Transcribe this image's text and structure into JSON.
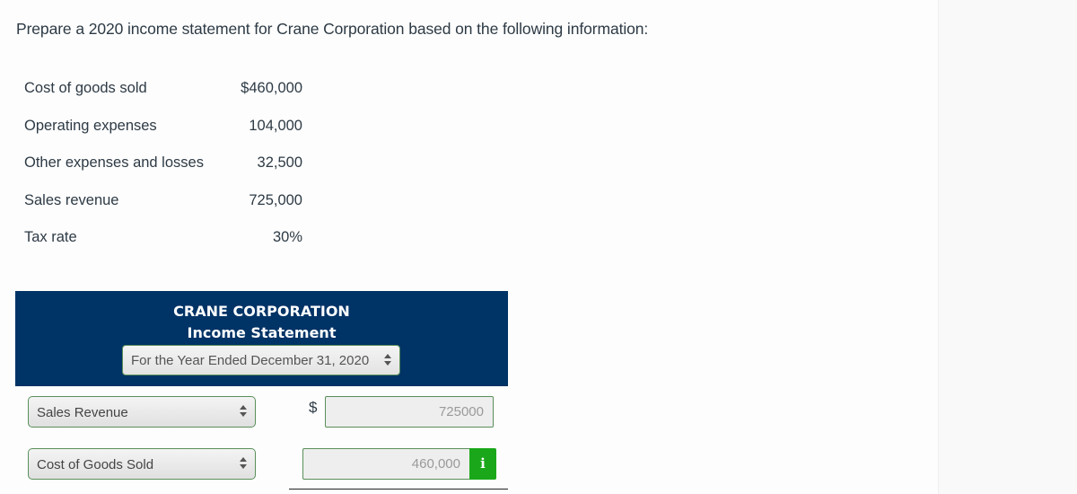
{
  "prompt": "Prepare a 2020 income statement for Crane Corporation based on the following information:",
  "given": [
    {
      "label": "Cost of goods sold",
      "value": "$460,000"
    },
    {
      "label": "Operating expenses",
      "value": "104,000"
    },
    {
      "label": "Other expenses and losses",
      "value": "32,500"
    },
    {
      "label": "Sales revenue",
      "value": "725,000"
    },
    {
      "label": "Tax rate",
      "value": "30%"
    }
  ],
  "statement": {
    "company": "CRANE CORPORATION",
    "title": "Income Statement",
    "period": "For the Year Ended December 31, 2020",
    "rows": [
      {
        "account": "Sales Revenue",
        "currency": "$",
        "amount": "725000"
      },
      {
        "account": "Cost of Goods Sold",
        "amount": "460,000",
        "info_label": "i"
      }
    ]
  },
  "colors": {
    "header_bg": "#003366",
    "input_border": "#5a8f5a",
    "info_button": "#1aa81a"
  }
}
